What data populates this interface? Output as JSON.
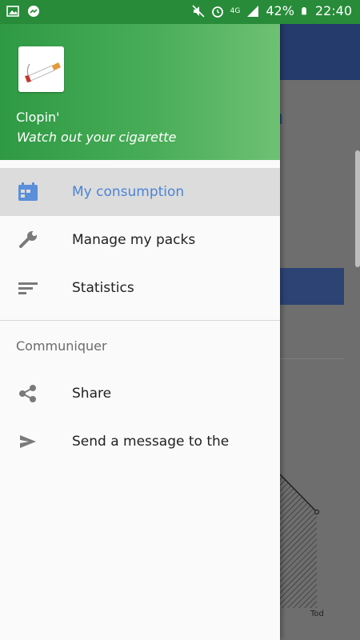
{
  "status_bar": {
    "battery_percent": "42%",
    "time": "22:40",
    "network": "4G"
  },
  "drawer": {
    "app_name": "Clopin'",
    "tagline": "Watch out your cigarette",
    "items": [
      {
        "label": "My consumption",
        "icon": "calendar-icon",
        "selected": true
      },
      {
        "label": "Manage my packs",
        "icon": "wrench-icon",
        "selected": false
      },
      {
        "label": "Statistics",
        "icon": "bars-icon",
        "selected": false
      }
    ],
    "section_title": "Communiquer",
    "section_items": [
      {
        "label": "Share",
        "icon": "share-icon"
      },
      {
        "label": "Send a message to the",
        "icon": "send-icon"
      }
    ]
  },
  "background": {
    "axis_label": "Tod"
  },
  "colors": {
    "header_green": "#2e9a43",
    "selected_text": "#4a84d6",
    "app_bar_blue": "#243b6b"
  }
}
